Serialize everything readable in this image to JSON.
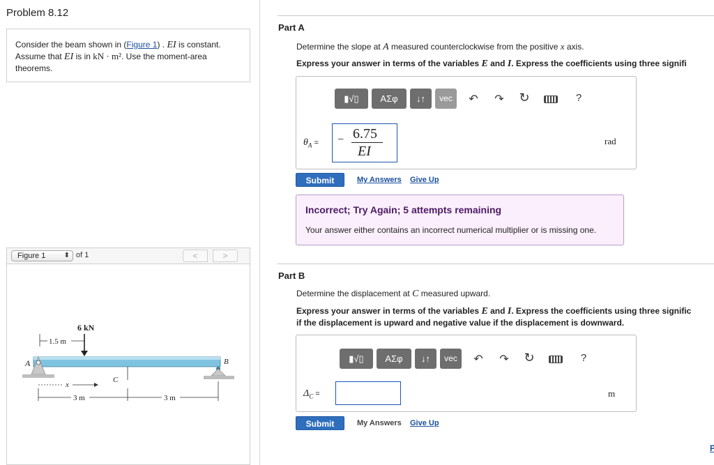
{
  "problem": {
    "title": "Problem 8.12",
    "text_1": "Consider the beam shown in (",
    "figure_link": "Figure 1",
    "text_2": ") .",
    "EI": "EI",
    "text_3": " is constant.",
    "text_4": "Assume that ",
    "text_5": " is in ",
    "unit": "kN · m²",
    "text_6": ". Use the moment-area",
    "text_7": "theorems."
  },
  "figure_nav": {
    "select_value": "Figure 1",
    "of_text": "of 1",
    "prev": "<",
    "next": ">"
  },
  "figure": {
    "load": "6 kN",
    "dim_load": "1.5 m",
    "point_A": "A",
    "point_B": "B",
    "point_C": "C",
    "x_label": "x",
    "dim_left": "3 m",
    "dim_right": "3 m"
  },
  "toolbar": {
    "templates": "▮√▯",
    "greek": "ΑΣφ",
    "arrows": "↓↑",
    "vec": "vec",
    "help": "?"
  },
  "partA": {
    "title": "Part A",
    "question_1": "Determine the slope at ",
    "question_var": "A",
    "question_2": " measured counterclockwise from the positive ",
    "question_x": "x",
    "question_3": " axis.",
    "instruction_1": "Express your answer in terms of the variables ",
    "var_E": "E",
    "and": " and ",
    "var_I": "I",
    "instruction_2": ". Express the coefficients using three signifi",
    "label": "θ",
    "label_sub": "A",
    "eq": " =",
    "minus": "−",
    "numerator": "6.75",
    "denominator": "EI",
    "unit": "rad",
    "submit": "Submit",
    "my_answers": "My Answers",
    "give_up": "Give Up"
  },
  "feedback": {
    "title": "Incorrect; Try Again; 5 attempts remaining",
    "text": "Your answer either contains an incorrect numerical multiplier or is missing one."
  },
  "partB": {
    "title": "Part B",
    "question_1": "Determine the displacement at ",
    "question_var": "C",
    "question_2": " measured upward.",
    "instruction_1": "Express your answer in terms of the variables ",
    "var_E": "E",
    "and": " and ",
    "var_I": "I",
    "instruction_2": ". Express the coefficients using three signific",
    "instruction_3": "if the displacement is upward and negative value if the displacement is downward.",
    "label": "Δ",
    "label_sub": "C",
    "eq": " =",
    "input_value": "",
    "unit": "m",
    "submit": "Submit",
    "my_answers": "My Answers",
    "give_up": "Give Up"
  },
  "edge_link": "P",
  "colors": {
    "submit": "#2f6ebd",
    "link": "#1a4f9c",
    "feedback_bg": "#fbeffd",
    "feedback_title": "#4b1a63",
    "beam": "#7fc3e0"
  }
}
